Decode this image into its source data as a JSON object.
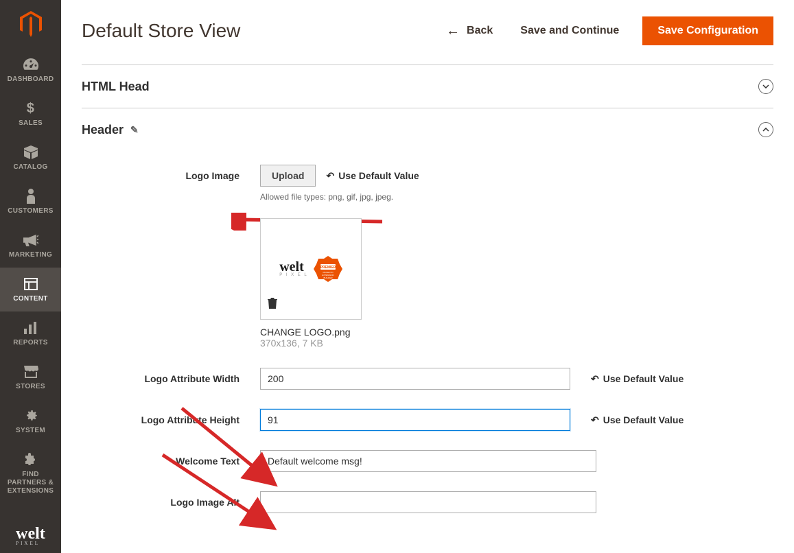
{
  "page": {
    "title": "Default Store View",
    "back_label": "Back",
    "save_continue_label": "Save and Continue",
    "save_config_label": "Save Configuration"
  },
  "sidebar": {
    "items": [
      {
        "label": "DASHBOARD"
      },
      {
        "label": "SALES"
      },
      {
        "label": "CATALOG"
      },
      {
        "label": "CUSTOMERS"
      },
      {
        "label": "MARKETING"
      },
      {
        "label": "CONTENT"
      },
      {
        "label": "REPORTS"
      },
      {
        "label": "STORES"
      },
      {
        "label": "SYSTEM"
      },
      {
        "label": "FIND PARTNERS & EXTENSIONS"
      }
    ]
  },
  "sections": {
    "html_head": {
      "title": "HTML Head"
    },
    "header": {
      "title": "Header"
    }
  },
  "form": {
    "logo_image": {
      "label": "Logo Image",
      "upload_label": "Upload",
      "use_default_label": "Use Default Value",
      "hint": "Allowed file types: png, gif, jpg, jpeg.",
      "file_name": "CHANGE LOGO.png",
      "file_meta": "370x136, 7 KB"
    },
    "logo_width": {
      "label": "Logo Attribute Width",
      "value": "200",
      "use_default_label": "Use Default Value"
    },
    "logo_height": {
      "label": "Logo Attribute Height",
      "value": "91",
      "use_default_label": "Use Default Value"
    },
    "welcome_text": {
      "label": "Welcome Text",
      "value": "Default welcome msg!"
    },
    "logo_alt": {
      "label": "Logo Image Alt",
      "value": ""
    }
  }
}
